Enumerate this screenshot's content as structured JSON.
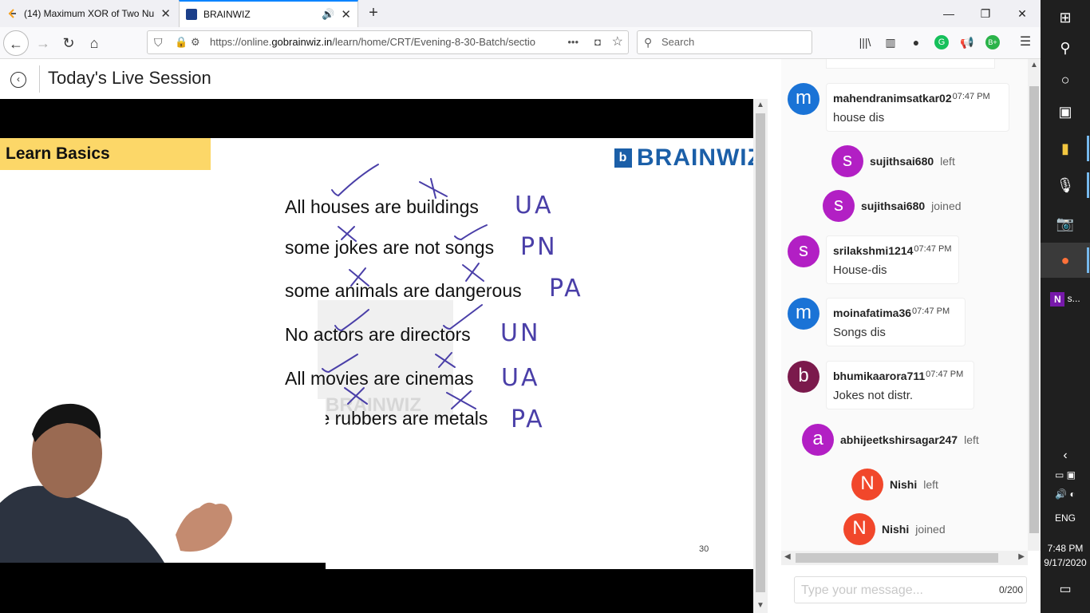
{
  "browser": {
    "tabs": [
      {
        "title": "(14) Maximum XOR of Two Nu"
      },
      {
        "title": "BRAINWIZ"
      }
    ],
    "url": {
      "prefix": "https://online.",
      "domain": "gobrainwiz.in",
      "path": "/learn/home/CRT/Evening-8-30-Batch/sectio"
    },
    "search_placeholder": "Search",
    "more_glyph": "•••"
  },
  "page": {
    "title": "Today's Live Session"
  },
  "slide": {
    "banner": "Learn Basics",
    "logo": "BRAINWIZ",
    "logo_mark": "b",
    "sentences": [
      {
        "text": "All houses are buildings",
        "annotation": "UA"
      },
      {
        "text": "some jokes are not songs",
        "annotation": "PN"
      },
      {
        "text": "some animals are dangerous",
        "annotation": "PA"
      },
      {
        "text": "No actors are directors",
        "annotation": "UN"
      },
      {
        "text": "All movies are cinemas",
        "annotation": "UA"
      },
      {
        "text": "some rubbers are metals",
        "annotation": "PA"
      }
    ],
    "page_number": "30",
    "watermark": "BRAINWIZ"
  },
  "chat": {
    "messages": [
      {
        "type": "message",
        "initial": "m",
        "color": "#1a73d6",
        "user": "mahendranimsatkar02",
        "time": "07:47 PM",
        "text": "house dis"
      },
      {
        "type": "event",
        "initial": "s",
        "color": "#b21fc4",
        "user": "sujithsai680",
        "action": "left"
      },
      {
        "type": "event",
        "initial": "s",
        "color": "#b21fc4",
        "user": "sujithsai680",
        "action": "joined"
      },
      {
        "type": "message",
        "initial": "s",
        "color": "#b21fc4",
        "user": "srilakshmi1214",
        "time": "07:47 PM",
        "text": "House-dis"
      },
      {
        "type": "message",
        "initial": "m",
        "color": "#1a73d6",
        "user": "moinafatima36",
        "time": "07:47 PM",
        "text": "Songs dis"
      },
      {
        "type": "message",
        "initial": "b",
        "color": "#7b1a4c",
        "user": "bhumikaarora711",
        "time": "07:47 PM",
        "text": "Jokes not distr."
      },
      {
        "type": "event",
        "initial": "a",
        "color": "#b21fc4",
        "user": "abhijeetkshirsagar247",
        "action": "left"
      },
      {
        "type": "event",
        "initial": "N",
        "color": "#f1472b",
        "user": "Nishi",
        "action": "left"
      },
      {
        "type": "event",
        "initial": "N",
        "color": "#f1472b",
        "user": "Nishi",
        "action": "joined"
      }
    ],
    "input_placeholder": "Type your message...",
    "char_count": "0/200"
  },
  "taskbar": {
    "onenote_label": "s...",
    "language": "ENG",
    "time": "7:48 PM",
    "date": "9/17/2020"
  }
}
